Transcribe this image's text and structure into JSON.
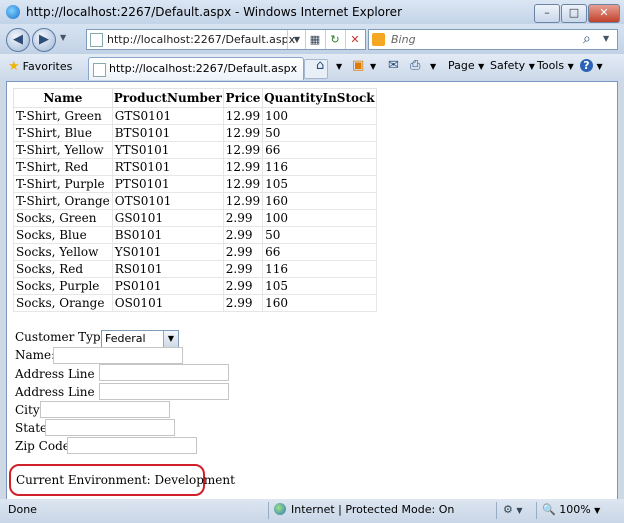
{
  "window": {
    "title": "http://localhost:2267/Default.aspx - Windows Internet Explorer",
    "minimize": "–",
    "maximize": "□",
    "close": "✕"
  },
  "nav": {
    "address": "http://localhost:2267/Default.aspx",
    "search_placeholder": "Bing",
    "search_glyph": "⌕"
  },
  "toolbar": {
    "favorites_label": "Favorites",
    "tab_label": "http://localhost:2267/Default.aspx",
    "page_label": "Page",
    "safety_label": "Safety",
    "tools_label": "Tools",
    "help_label": "?"
  },
  "grid": {
    "headers": [
      "Name",
      "ProductNumber",
      "Price",
      "QuantityInStock"
    ],
    "rows": [
      [
        "T-Shirt, Green",
        "GTS0101",
        "12.99",
        "100"
      ],
      [
        "T-Shirt, Blue",
        "BTS0101",
        "12.99",
        "50"
      ],
      [
        "T-Shirt, Yellow",
        "YTS0101",
        "12.99",
        "66"
      ],
      [
        "T-Shirt, Red",
        "RTS0101",
        "12.99",
        "116"
      ],
      [
        "T-Shirt, Purple",
        "PTS0101",
        "12.99",
        "105"
      ],
      [
        "T-Shirt, Orange",
        "OTS0101",
        "12.99",
        "160"
      ],
      [
        "Socks, Green",
        "GS0101",
        "2.99",
        "100"
      ],
      [
        "Socks, Blue",
        "BS0101",
        "2.99",
        "50"
      ],
      [
        "Socks, Yellow",
        "YS0101",
        "2.99",
        "66"
      ],
      [
        "Socks, Red",
        "RS0101",
        "2.99",
        "116"
      ],
      [
        "Socks, Purple",
        "PS0101",
        "2.99",
        "105"
      ],
      [
        "Socks, Orange",
        "OS0101",
        "2.99",
        "160"
      ]
    ]
  },
  "form": {
    "customer_type_label": "Customer Type:",
    "customer_type_value": "Federal",
    "name_label": "Name:",
    "address1_label": "Address Line 1:",
    "address2_label": "Address Line 2:",
    "city_label": "City",
    "state_label": "State",
    "zip_label": "Zip Code",
    "environment_text": "Current Environment: Development"
  },
  "status": {
    "left": "Done",
    "zone": "Internet | Protected Mode: On",
    "zoom": "100%"
  },
  "colors": {
    "highlight_border": "#d0202a",
    "content_border": "#7b97bf"
  }
}
